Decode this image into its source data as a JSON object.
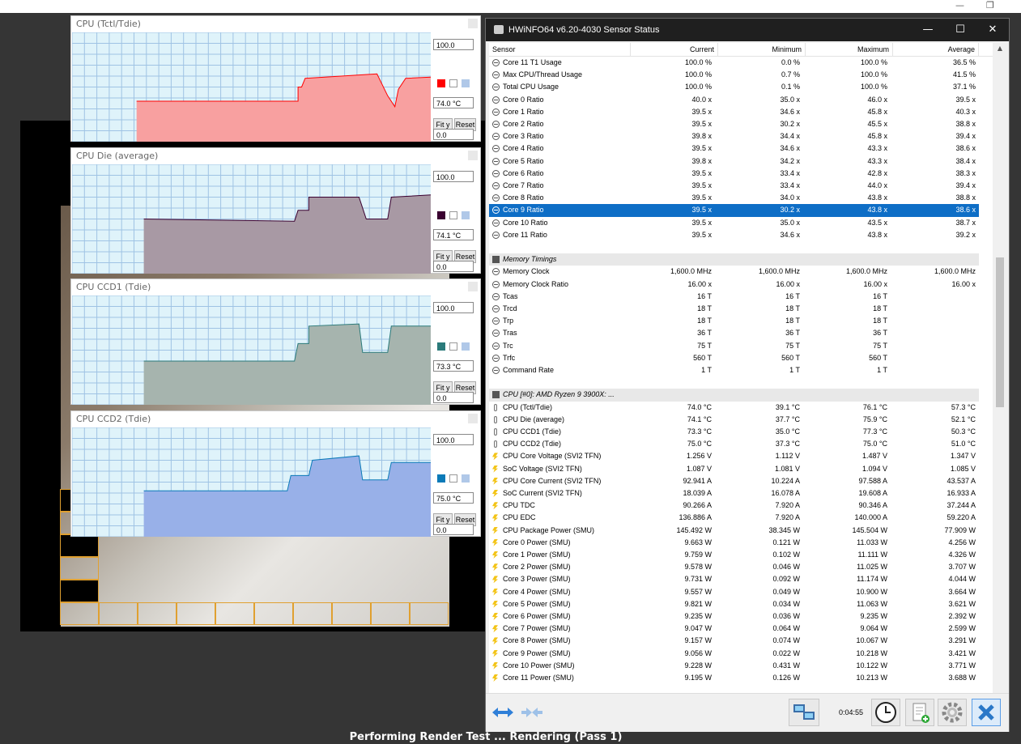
{
  "status_text": "Performing Render Test ... Rendering (Pass 1)",
  "graphs": [
    {
      "title": "CPU (Tctl/Tdie)",
      "max": "100.0",
      "current": "74.0 °C",
      "min": "0.0",
      "fit_label": "Fit y",
      "reset_label": "Reset",
      "color": "#ff0000",
      "fill": "#f8a0a0"
    },
    {
      "title": "CPU Die (average)",
      "max": "100.0",
      "current": "74.1 °C",
      "min": "0.0",
      "fit_label": "Fit y",
      "reset_label": "Reset",
      "color": "#3a0030",
      "fill": "#a899a4"
    },
    {
      "title": "CPU CCD1 (Tdie)",
      "max": "100.0",
      "current": "73.3 °C",
      "min": "0.0",
      "fit_label": "Fit y",
      "reset_label": "Reset",
      "color": "#2a7a7a",
      "fill": "#a6b4ae"
    },
    {
      "title": "CPU CCD2 (Tdie)",
      "max": "100.0",
      "current": "75.0 °C",
      "min": "0.0",
      "fit_label": "Fit y",
      "reset_label": "Reset",
      "color": "#0a7ab8",
      "fill": "#98b0e8"
    }
  ],
  "sensor_window": {
    "title": "HWiNFO64 v6.20-4030 Sensor Status",
    "columns": [
      "Sensor",
      "Current",
      "Minimum",
      "Maximum",
      "Average"
    ],
    "timer": "0:04:55",
    "rows": [
      {
        "icon": "clock",
        "name": "Core 11 T1 Usage",
        "cur": "100.0 %",
        "min": "0.0 %",
        "max": "100.0 %",
        "avg": "36.5 %"
      },
      {
        "icon": "clock",
        "name": "Max CPU/Thread Usage",
        "cur": "100.0 %",
        "min": "0.7 %",
        "max": "100.0 %",
        "avg": "41.5 %"
      },
      {
        "icon": "clock",
        "name": "Total CPU Usage",
        "cur": "100.0 %",
        "min": "0.1 %",
        "max": "100.0 %",
        "avg": "37.1 %"
      },
      {
        "icon": "clock",
        "name": "Core 0 Ratio",
        "cur": "40.0 x",
        "min": "35.0 x",
        "max": "46.0 x",
        "avg": "39.5 x"
      },
      {
        "icon": "clock",
        "name": "Core 1 Ratio",
        "cur": "39.5 x",
        "min": "34.6 x",
        "max": "45.8 x",
        "avg": "40.3 x"
      },
      {
        "icon": "clock",
        "name": "Core 2 Ratio",
        "cur": "39.5 x",
        "min": "30.2 x",
        "max": "45.5 x",
        "avg": "38.8 x"
      },
      {
        "icon": "clock",
        "name": "Core 3 Ratio",
        "cur": "39.8 x",
        "min": "34.4 x",
        "max": "45.8 x",
        "avg": "39.4 x"
      },
      {
        "icon": "clock",
        "name": "Core 4 Ratio",
        "cur": "39.5 x",
        "min": "34.6 x",
        "max": "43.3 x",
        "avg": "38.6 x"
      },
      {
        "icon": "clock",
        "name": "Core 5 Ratio",
        "cur": "39.8 x",
        "min": "34.2 x",
        "max": "43.3 x",
        "avg": "38.4 x"
      },
      {
        "icon": "clock",
        "name": "Core 6 Ratio",
        "cur": "39.5 x",
        "min": "33.4 x",
        "max": "42.8 x",
        "avg": "38.3 x"
      },
      {
        "icon": "clock",
        "name": "Core 7 Ratio",
        "cur": "39.5 x",
        "min": "33.4 x",
        "max": "44.0 x",
        "avg": "39.4 x"
      },
      {
        "icon": "clock",
        "name": "Core 8 Ratio",
        "cur": "39.5 x",
        "min": "34.0 x",
        "max": "43.8 x",
        "avg": "38.8 x"
      },
      {
        "icon": "clock",
        "name": "Core 9 Ratio",
        "cur": "39.5 x",
        "min": "30.2 x",
        "max": "43.8 x",
        "avg": "38.6 x",
        "selected": true
      },
      {
        "icon": "clock",
        "name": "Core 10 Ratio",
        "cur": "39.5 x",
        "min": "35.0 x",
        "max": "43.5 x",
        "avg": "38.7 x"
      },
      {
        "icon": "clock",
        "name": "Core 11 Ratio",
        "cur": "39.5 x",
        "min": "34.6 x",
        "max": "43.8 x",
        "avg": "39.2 x"
      },
      {
        "icon": "none",
        "name": "",
        "cur": "",
        "min": "",
        "max": "",
        "avg": ""
      },
      {
        "icon": "chip",
        "name": "Memory Timings",
        "cur": "",
        "min": "",
        "max": "",
        "avg": "",
        "group": true
      },
      {
        "icon": "clock",
        "name": "Memory Clock",
        "cur": "1,600.0 MHz",
        "min": "1,600.0 MHz",
        "max": "1,600.0 MHz",
        "avg": "1,600.0 MHz"
      },
      {
        "icon": "clock",
        "name": "Memory Clock Ratio",
        "cur": "16.00 x",
        "min": "16.00 x",
        "max": "16.00 x",
        "avg": "16.00 x"
      },
      {
        "icon": "clock",
        "name": "Tcas",
        "cur": "16 T",
        "min": "16 T",
        "max": "16 T",
        "avg": ""
      },
      {
        "icon": "clock",
        "name": "Trcd",
        "cur": "18 T",
        "min": "18 T",
        "max": "18 T",
        "avg": ""
      },
      {
        "icon": "clock",
        "name": "Trp",
        "cur": "18 T",
        "min": "18 T",
        "max": "18 T",
        "avg": ""
      },
      {
        "icon": "clock",
        "name": "Tras",
        "cur": "36 T",
        "min": "36 T",
        "max": "36 T",
        "avg": ""
      },
      {
        "icon": "clock",
        "name": "Trc",
        "cur": "75 T",
        "min": "75 T",
        "max": "75 T",
        "avg": ""
      },
      {
        "icon": "clock",
        "name": "Trfc",
        "cur": "560 T",
        "min": "560 T",
        "max": "560 T",
        "avg": ""
      },
      {
        "icon": "clock",
        "name": "Command Rate",
        "cur": "1 T",
        "min": "1 T",
        "max": "1 T",
        "avg": ""
      },
      {
        "icon": "none",
        "name": "",
        "cur": "",
        "min": "",
        "max": "",
        "avg": ""
      },
      {
        "icon": "chip",
        "name": "CPU [#0]: AMD Ryzen 9 3900X: ...",
        "cur": "",
        "min": "",
        "max": "",
        "avg": "",
        "group": true
      },
      {
        "icon": "therm",
        "name": "CPU (Tctl/Tdie)",
        "cur": "74.0 °C",
        "min": "39.1 °C",
        "max": "76.1 °C",
        "avg": "57.3 °C"
      },
      {
        "icon": "therm",
        "name": "CPU Die (average)",
        "cur": "74.1 °C",
        "min": "37.7 °C",
        "max": "75.9 °C",
        "avg": "52.1 °C"
      },
      {
        "icon": "therm",
        "name": "CPU CCD1 (Tdie)",
        "cur": "73.3 °C",
        "min": "35.0 °C",
        "max": "77.3 °C",
        "avg": "50.3 °C"
      },
      {
        "icon": "therm",
        "name": "CPU CCD2 (Tdie)",
        "cur": "75.0 °C",
        "min": "37.3 °C",
        "max": "75.0 °C",
        "avg": "51.0 °C"
      },
      {
        "icon": "bolt",
        "name": "CPU Core Voltage (SVI2 TFN)",
        "cur": "1.256 V",
        "min": "1.112 V",
        "max": "1.487 V",
        "avg": "1.347 V"
      },
      {
        "icon": "bolt",
        "name": "SoC Voltage (SVI2 TFN)",
        "cur": "1.087 V",
        "min": "1.081 V",
        "max": "1.094 V",
        "avg": "1.085 V"
      },
      {
        "icon": "bolt",
        "name": "CPU Core Current (SVI2 TFN)",
        "cur": "92.941 A",
        "min": "10.224 A",
        "max": "97.588 A",
        "avg": "43.537 A"
      },
      {
        "icon": "bolt",
        "name": "SoC Current (SVI2 TFN)",
        "cur": "18.039 A",
        "min": "16.078 A",
        "max": "19.608 A",
        "avg": "16.933 A"
      },
      {
        "icon": "bolt",
        "name": "CPU TDC",
        "cur": "90.266 A",
        "min": "7.920 A",
        "max": "90.346 A",
        "avg": "37.244 A"
      },
      {
        "icon": "bolt",
        "name": "CPU EDC",
        "cur": "136.886 A",
        "min": "7.920 A",
        "max": "140.000 A",
        "avg": "59.220 A"
      },
      {
        "icon": "bolt",
        "name": "CPU Package Power (SMU)",
        "cur": "145.492 W",
        "min": "38.345 W",
        "max": "145.504 W",
        "avg": "77.909 W"
      },
      {
        "icon": "bolt",
        "name": "Core 0 Power (SMU)",
        "cur": "9.663 W",
        "min": "0.121 W",
        "max": "11.033 W",
        "avg": "4.256 W"
      },
      {
        "icon": "bolt",
        "name": "Core 1 Power (SMU)",
        "cur": "9.759 W",
        "min": "0.102 W",
        "max": "11.111 W",
        "avg": "4.326 W"
      },
      {
        "icon": "bolt",
        "name": "Core 2 Power (SMU)",
        "cur": "9.578 W",
        "min": "0.046 W",
        "max": "11.025 W",
        "avg": "3.707 W"
      },
      {
        "icon": "bolt",
        "name": "Core 3 Power (SMU)",
        "cur": "9.731 W",
        "min": "0.092 W",
        "max": "11.174 W",
        "avg": "4.044 W"
      },
      {
        "icon": "bolt",
        "name": "Core 4 Power (SMU)",
        "cur": "9.557 W",
        "min": "0.049 W",
        "max": "10.900 W",
        "avg": "3.664 W"
      },
      {
        "icon": "bolt",
        "name": "Core 5 Power (SMU)",
        "cur": "9.821 W",
        "min": "0.034 W",
        "max": "11.063 W",
        "avg": "3.621 W"
      },
      {
        "icon": "bolt",
        "name": "Core 6 Power (SMU)",
        "cur": "9.235 W",
        "min": "0.036 W",
        "max": "9.235 W",
        "avg": "2.392 W"
      },
      {
        "icon": "bolt",
        "name": "Core 7 Power (SMU)",
        "cur": "9.047 W",
        "min": "0.064 W",
        "max": "9.064 W",
        "avg": "2.599 W"
      },
      {
        "icon": "bolt",
        "name": "Core 8 Power (SMU)",
        "cur": "9.157 W",
        "min": "0.074 W",
        "max": "10.067 W",
        "avg": "3.291 W"
      },
      {
        "icon": "bolt",
        "name": "Core 9 Power (SMU)",
        "cur": "9.056 W",
        "min": "0.022 W",
        "max": "10.218 W",
        "avg": "3.421 W"
      },
      {
        "icon": "bolt",
        "name": "Core 10 Power (SMU)",
        "cur": "9.228 W",
        "min": "0.431 W",
        "max": "10.122 W",
        "avg": "3.771 W"
      },
      {
        "icon": "bolt",
        "name": "Core 11 Power (SMU)",
        "cur": "9.195 W",
        "min": "0.126 W",
        "max": "10.213 W",
        "avg": "3.688 W"
      }
    ]
  }
}
